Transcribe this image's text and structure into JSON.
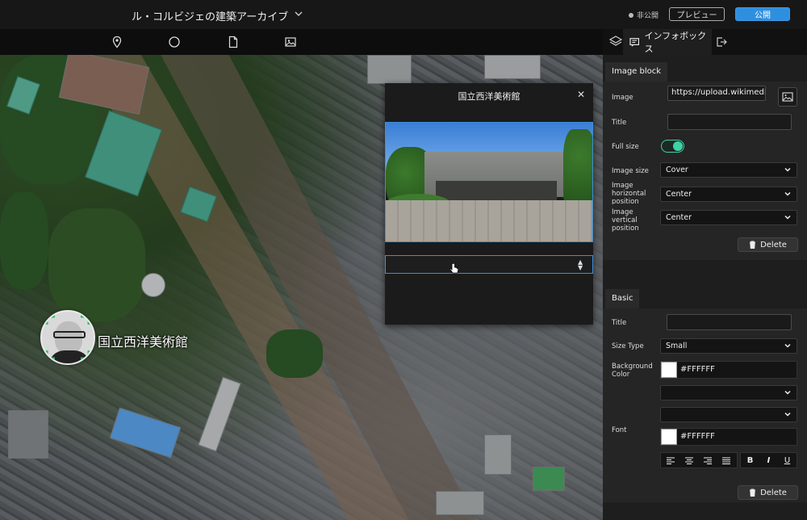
{
  "header": {
    "app_title": "ル・コルビジェの建築アーカイブ",
    "status": "非公開",
    "preview_label": "プレビュー",
    "publish_label": "公開"
  },
  "map": {
    "marker_label": "国立西洋美術館"
  },
  "infobox_popup": {
    "title": "国立西洋美術館",
    "close_glyph": "✕",
    "select_value": ""
  },
  "panel_tabs": {
    "infobox_tab_label": "インフォボックス"
  },
  "image_block": {
    "header": "Image block",
    "image_label": "Image",
    "image_url": "https://upload.wikimedia.c",
    "title_label": "Title",
    "title_value": "",
    "full_size_label": "Full size",
    "full_size_on": true,
    "image_size_label": "Image size",
    "image_size_value": "Cover",
    "h_pos_label": "Image horizontal position",
    "h_pos_value": "Center",
    "v_pos_label": "Image vertical position",
    "v_pos_value": "Center",
    "delete_label": "Delete"
  },
  "basic_block": {
    "header": "Basic",
    "title_label": "Title",
    "title_value": "",
    "size_type_label": "Size Type",
    "size_type_value": "Small",
    "bg_color_label": "Background Color",
    "bg_color_value": "#FFFFFF",
    "font_label": "Font",
    "font_color_value": "#FFFFFF",
    "format_buttons": [
      "B",
      "I",
      "U"
    ],
    "delete_label": "Delete"
  },
  "colors": {
    "accent": "#2f8fdf",
    "toggle": "#3fd1a6",
    "panel_bg": "#1e1e1e"
  },
  "icons": [
    "chevron-down-icon",
    "pin-icon",
    "circle-icon",
    "file-icon",
    "image-icon",
    "layers-icon",
    "infobox-icon",
    "exit-icon",
    "close-icon",
    "trash-icon",
    "align-left-icon",
    "align-center-icon",
    "align-right-icon",
    "align-justify-icon"
  ]
}
